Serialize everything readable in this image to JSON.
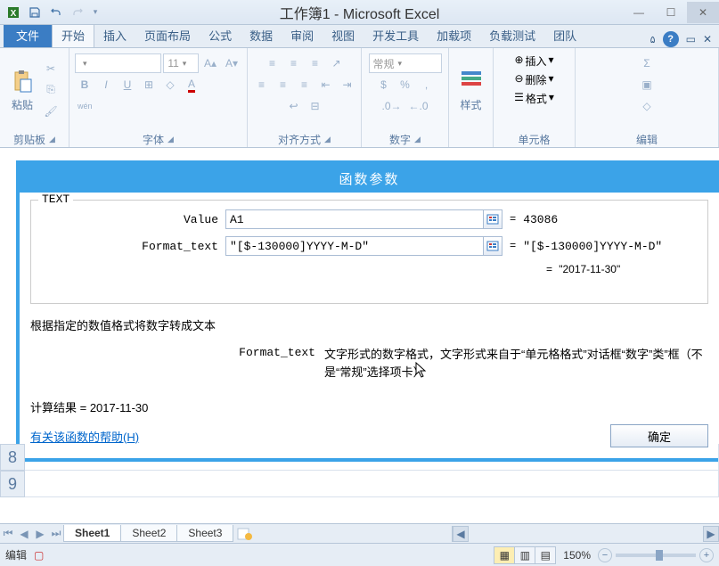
{
  "titlebar": {
    "title": "工作簿1 - Microsoft Excel"
  },
  "ribbon": {
    "tabs": {
      "file": "文件",
      "home": "开始",
      "insert": "插入",
      "layout": "页面布局",
      "formulas": "公式",
      "data": "数据",
      "review": "审阅",
      "view": "视图",
      "dev": "开发工具",
      "addins": "加载项",
      "loadtest": "负载测试",
      "team": "团队"
    },
    "groups": {
      "clipboard": "剪贴板",
      "paste": "粘贴",
      "font": "字体",
      "font_size": "11",
      "align": "对齐方式",
      "number": "数字",
      "number_format": "常规",
      "styles": "样式",
      "cells": "单元格",
      "insert_btn": "插入",
      "delete_btn": "删除",
      "format_btn": "格式",
      "editing": "编辑"
    }
  },
  "dialog": {
    "title": "函数参数",
    "fn_name": "TEXT",
    "labels": {
      "value": "Value",
      "format_text": "Format_text"
    },
    "inputs": {
      "value": "A1",
      "format_text": "\"[$-130000]YYYY-M-D\""
    },
    "evals": {
      "value": "43086",
      "format_text": "\"[$-130000]YYYY-M-D\"",
      "final": "\"2017-11-30\""
    },
    "eq": "=",
    "description": "根据指定的数值格式将数字转成文本",
    "param_name": "Format_text",
    "param_desc": "文字形式的数字格式，文字形式来自于“单元格格式”对话框“数字”类”框（不是“常规”选择项卡）",
    "calc_label": "计算结果 = ",
    "calc_value": "2017-11-30",
    "help": "有关该函数的帮助(H)",
    "ok": "确定"
  },
  "sheet": {
    "rows": {
      "r8": "8",
      "r9": "9"
    },
    "tabs": {
      "s1": "Sheet1",
      "s2": "Sheet2",
      "s3": "Sheet3"
    }
  },
  "status": {
    "mode": "编辑",
    "zoom": "150%"
  }
}
